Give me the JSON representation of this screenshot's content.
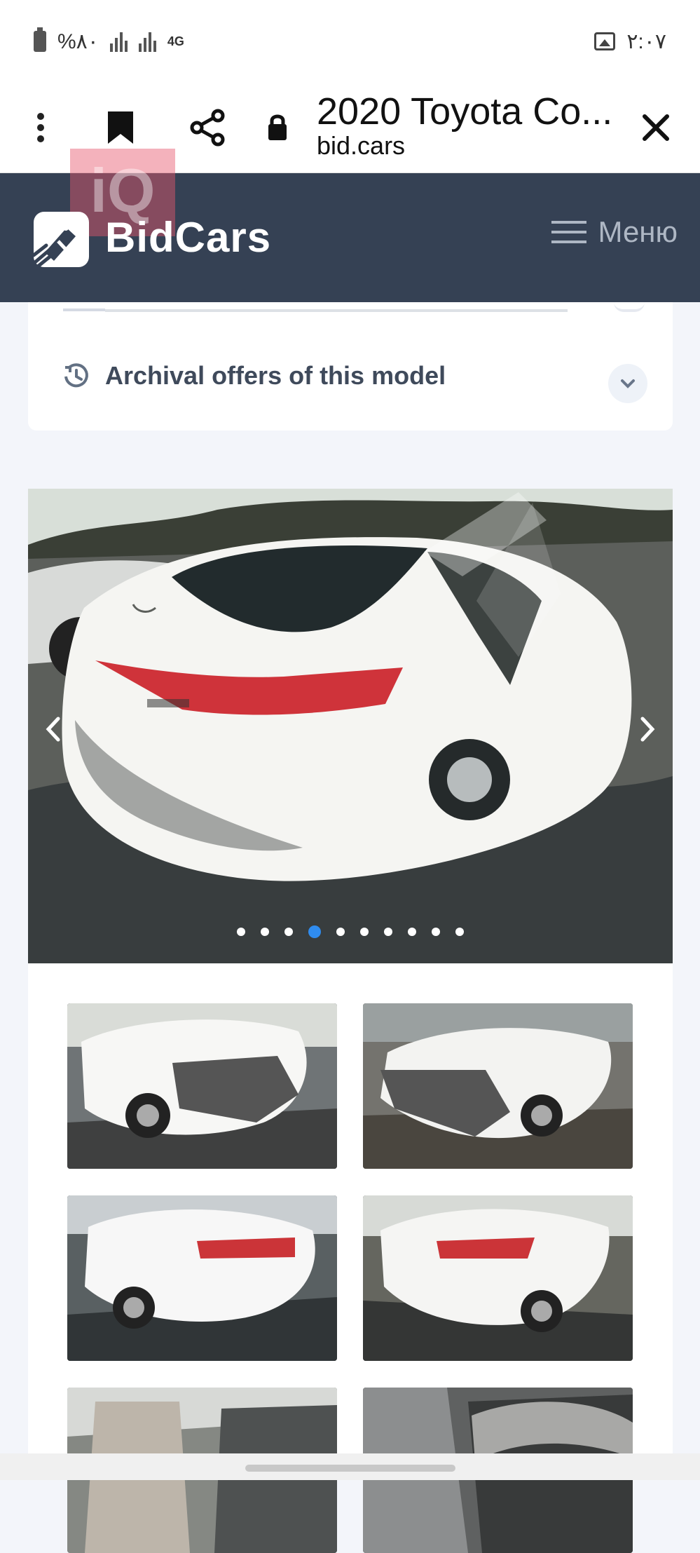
{
  "status_bar": {
    "battery_text": "%۸۰",
    "network_type": "4G",
    "time": "۲:۰۷"
  },
  "browser": {
    "title": "2020 Toyota Co...",
    "host": "bid.cars",
    "icons": [
      "more-vertical-icon",
      "bookmark-icon",
      "share-icon",
      "lock-icon",
      "close-icon"
    ]
  },
  "site_header": {
    "watermark": "iQ",
    "brand": "BidCars",
    "menu_label": "Меню"
  },
  "archive": {
    "label": "Archival offers of this model"
  },
  "gallery": {
    "total_images": 10,
    "active_image": 4
  },
  "colors": {
    "header": "#354154",
    "active_dot": "#2f8cef",
    "page_background": "#f3f5fa"
  }
}
